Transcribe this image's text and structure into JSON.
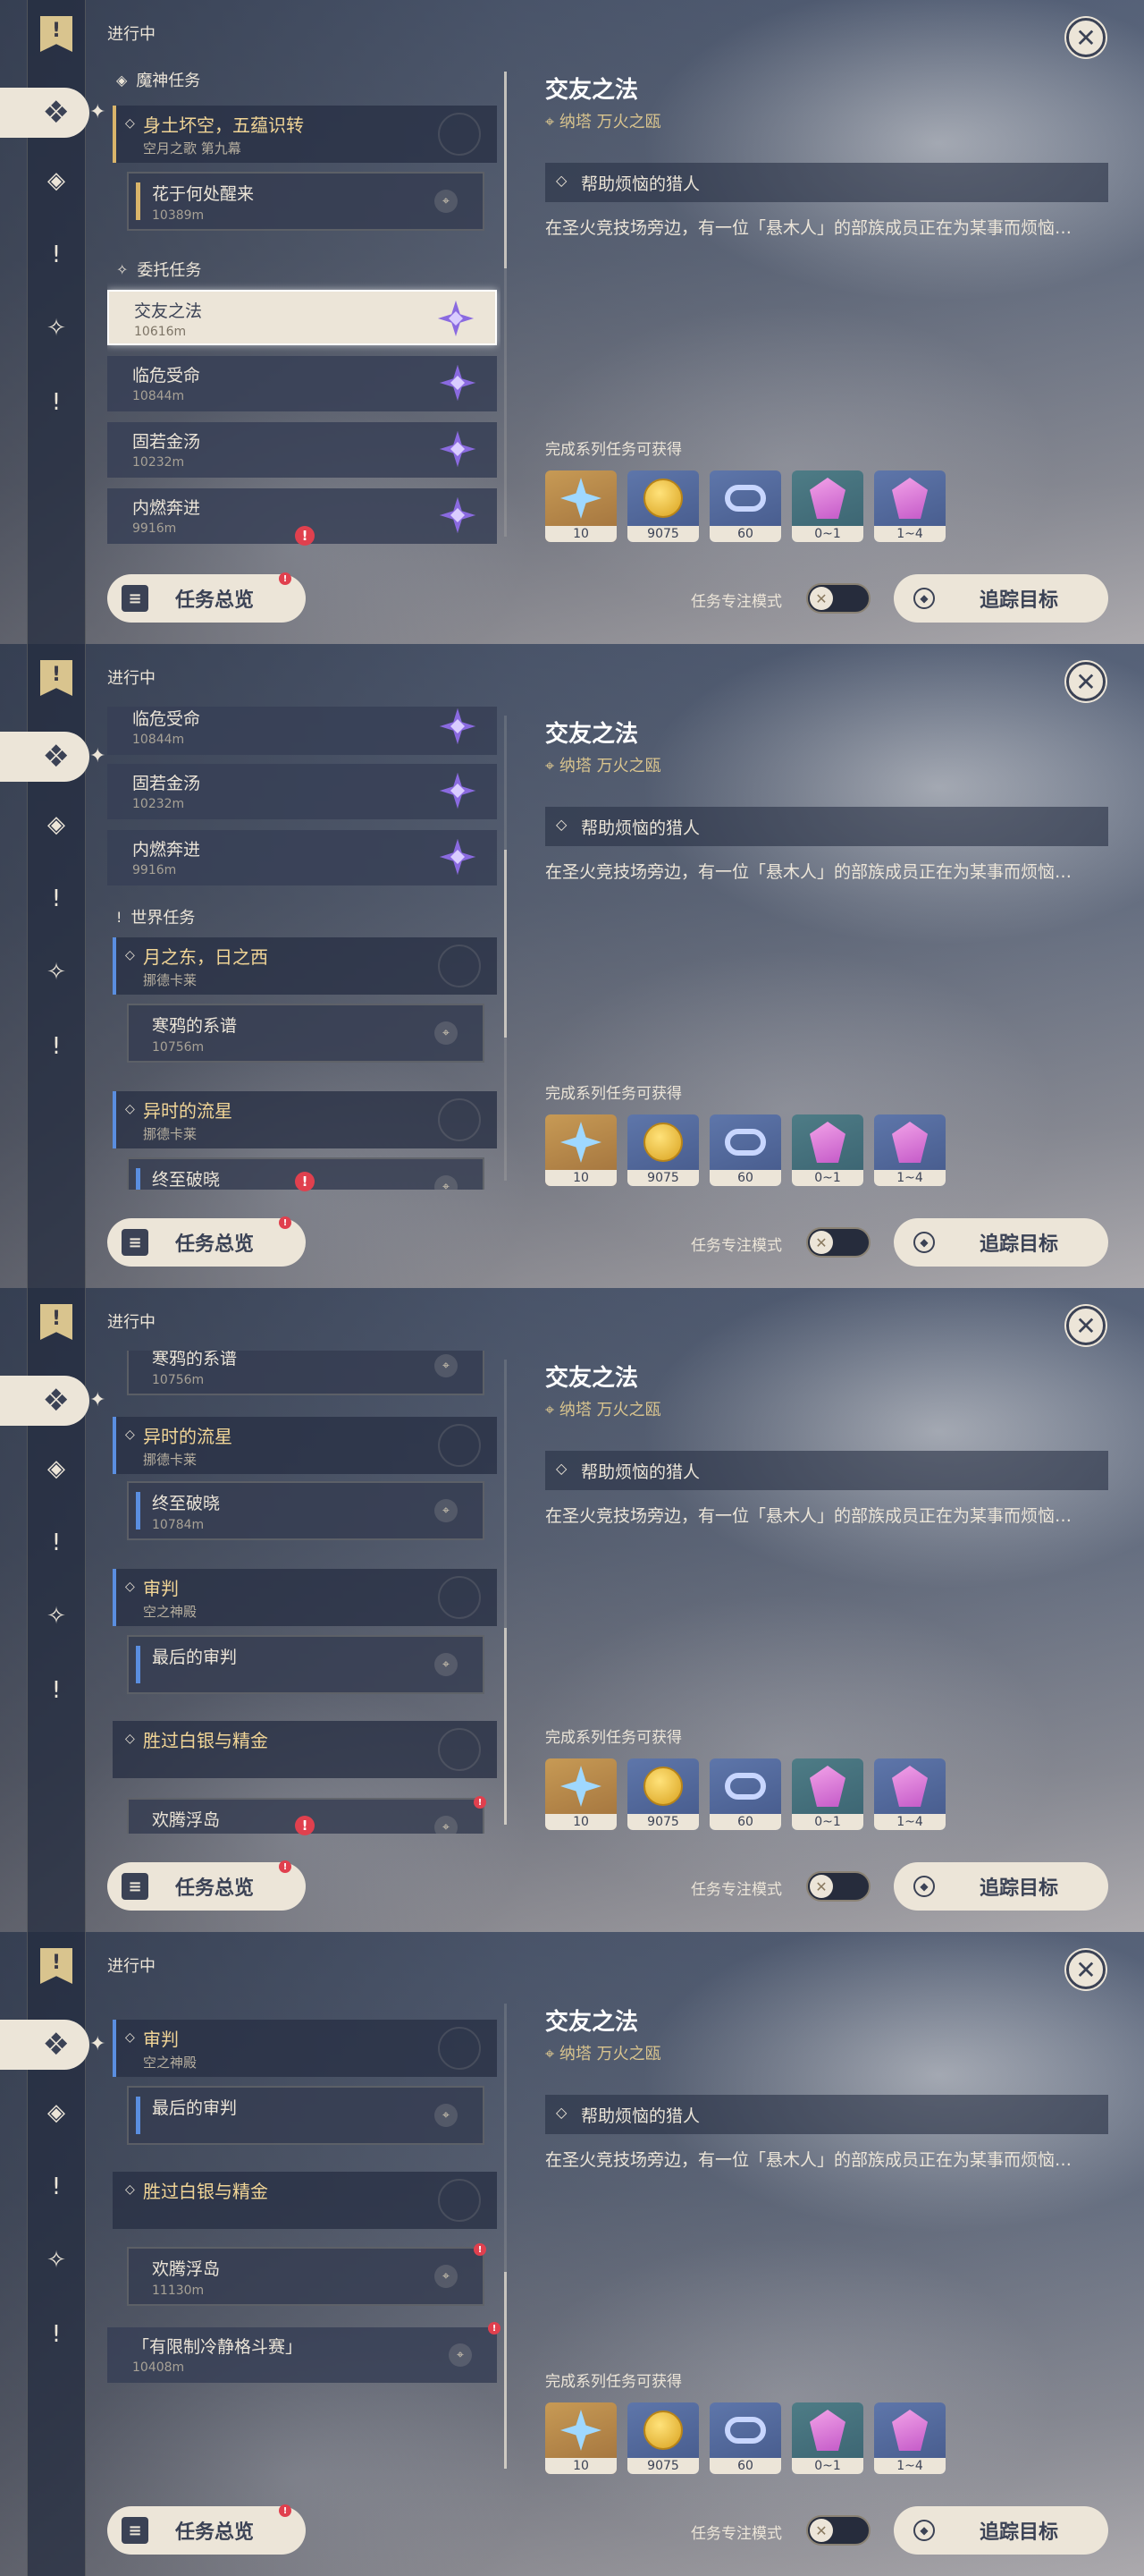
{
  "header": {
    "in_progress_label": "进行中"
  },
  "sections": {
    "archon": "魔神任务",
    "commission": "委托任务",
    "world": "世界任务"
  },
  "archon_quest": {
    "title": "身土坏空，五蕴识转",
    "subtitle": "空月之歌 第九幕"
  },
  "archon_step": {
    "name": "花于何处醒来",
    "dist": "10389m"
  },
  "commissions": [
    {
      "name": "交友之法",
      "dist": "10616m"
    },
    {
      "name": "临危受命",
      "dist": "10844m"
    },
    {
      "name": "固若金汤",
      "dist": "10232m"
    },
    {
      "name": "内燃奔进",
      "dist": "9916m"
    }
  ],
  "world_quests": {
    "moon": {
      "title": "月之东，日之西",
      "subtitle": "挪德卡莱"
    },
    "moon_step": {
      "name": "寒鸦的系谱",
      "dist": "10756m"
    },
    "meteor": {
      "title": "异时的流星",
      "subtitle": "挪德卡莱"
    },
    "meteor_step": {
      "name": "终至破晓",
      "dist": "10784m"
    },
    "judgment": {
      "title": "审判",
      "subtitle": "空之神殿"
    },
    "judgment_step": {
      "name": "最后的审判"
    },
    "silver": {
      "title": "胜过白银与精金"
    },
    "silver_step": {
      "name": "欢腾浮岛",
      "dist": "11130m"
    },
    "limited": {
      "name": "「有限制冷静格斗赛」",
      "dist": "10408m"
    }
  },
  "detail": {
    "title": "交友之法",
    "location": "纳塔 万火之瓯",
    "step": "帮助烦恼的猎人",
    "description": "在圣火竞技场旁边，有一位「悬木人」的部族成员正在为某事而烦恼…",
    "reward_label": "完成系列任务可获得",
    "rewards": [
      {
        "icon": "primogem-icon",
        "value": "10"
      },
      {
        "icon": "mora-icon",
        "value": "9075"
      },
      {
        "icon": "exp-ring-icon",
        "value": "60"
      },
      {
        "icon": "crystal-icon",
        "value": "0~1"
      },
      {
        "icon": "crystal-cluster-icon",
        "value": "1~4"
      }
    ]
  },
  "controls": {
    "overview": "任务总览",
    "focus_mode": "任务专注模式",
    "track": "追踪目标"
  }
}
